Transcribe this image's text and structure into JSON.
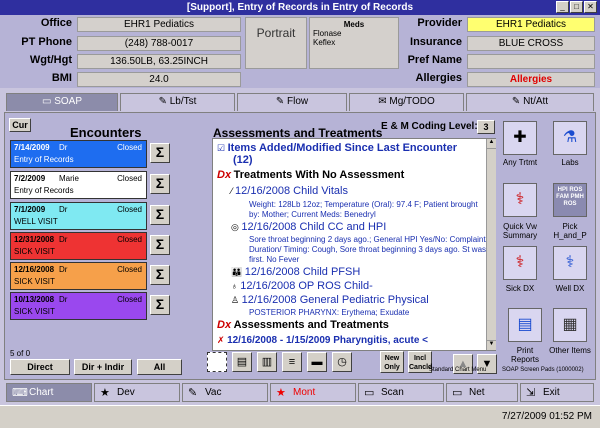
{
  "window": {
    "title": "[Support], Entry of Records in Entry of Records"
  },
  "header": {
    "office_label": "Office",
    "office_value": "EHR1 Pediatics",
    "phone_label": "PT Phone",
    "phone_value": "(248) 788-0017",
    "wgt_label": "Wgt/Hgt",
    "wgt_value": "136.50LB, 63.25INCH",
    "bmi_label": "BMI",
    "bmi_value": "24.0",
    "portrait_label": "Portrait",
    "meds_label": "Meds",
    "meds_items": [
      "Flonase",
      "Keflex"
    ],
    "provider_label": "Provider",
    "provider_value": "EHR1 Pediatics",
    "insurance_label": "Insurance",
    "insurance_value": "BLUE CROSS",
    "prefname_label": "Pref Name",
    "prefname_value": "",
    "allergies_label": "Allergies",
    "allergies_value": "Allergies"
  },
  "tabs": [
    "SOAP",
    "Lb/Tst",
    "Flow",
    "Mg/TODO",
    "Nt/Att"
  ],
  "encounters": {
    "cur_label": "Cur",
    "title": "Encounters",
    "items": [
      {
        "date": "7/14/2009",
        "dr": "Dr",
        "status": "Closed",
        "type": "Entry of Records",
        "color": "#1e6df0",
        "text": "#ffffff"
      },
      {
        "date": "7/2/2009",
        "dr": "Marie",
        "status": "Closed",
        "type": "Entry of Records",
        "color": "#ffffff",
        "text": "#000000"
      },
      {
        "date": "7/1/2009",
        "dr": "Dr",
        "status": "Closed",
        "type": "WELL VISIT",
        "color": "#7fe9f2",
        "text": "#000000"
      },
      {
        "date": "12/31/2008",
        "dr": "Dr",
        "status": "Closed",
        "type": "SICK VISIT",
        "color": "#ee3333",
        "text": "#000000"
      },
      {
        "date": "12/16/2008",
        "dr": "Dr",
        "status": "Closed",
        "type": "SICK VISIT",
        "color": "#f6a04a",
        "text": "#000000"
      },
      {
        "date": "10/13/2008",
        "dr": "Dr",
        "status": "Closed",
        "type": "SICK VISIT",
        "color": "#9a48ee",
        "text": "#000000"
      }
    ],
    "sigma": "Σ",
    "page_info": "5 of 0",
    "btn_direct": "Direct",
    "btn_dir_indir": "Dir + Indir",
    "btn_all": "All"
  },
  "assessment": {
    "title": "Assessments and Treatments",
    "coding_label": "E & M Coding Level:",
    "coding_value": "3",
    "items_added": "Items Added/Modified Since Last Encounter",
    "items_added_count": "(12)",
    "no_assess": "Treatments With No Assessment",
    "vitals_title": "12/16/2008 Child Vitals",
    "vitals_detail": "Weight: 128Lb 12oz; Temperature (Oral): 97.4 F; Patient brought by: Mother; Current Meds: Benedryl",
    "cc_title": "12/16/2008 Child CC and HPI",
    "cc_detail": "Sore throat beginning 2 days ago.; General HPI Yes/No: Complaint/ Duration/ Timing: Cough, Sore throat beginning 3 days ago. St was first.   No Fever",
    "pfsh_title": "12/16/2008 Child PFSH",
    "ros_title": "12/16/2008 OP ROS Child-",
    "gpp_title": "12/16/2008 General Pediatric Physical",
    "gpp_detail": "POSTERIOR PHARYNX: Erythema; Exudate",
    "assess_treat": "Assessments and Treatments",
    "pharyng": "12/16/2008 - 1/15/2009  Pharyngitis, acute <",
    "dx": "Dx"
  },
  "right": {
    "any_trtmt": "Any Trtmt",
    "labs": "Labs",
    "quick_vw": "Quick Vw Summary",
    "pick": "Pick H_and_P",
    "pick_icon": "HPI ROS FAM PMH ROS",
    "sick_dx": "Sick DX",
    "well_dx": "Well DX",
    "print_reports": "Print Reports",
    "other_items": "Other Items",
    "soap_screen": "SOAP Screen Pads (1000002)",
    "standard_chart": "Standard Chart Menu"
  },
  "toolbar": {
    "new_only": "New Only",
    "incl_cancel": "Incl Cancld"
  },
  "bottom_tabs": [
    "Chart",
    "Dev",
    "Mont",
    "Scan",
    "Net",
    "Exit"
  ],
  "status": {
    "datetime": "7/27/2009  01:52 PM"
  }
}
